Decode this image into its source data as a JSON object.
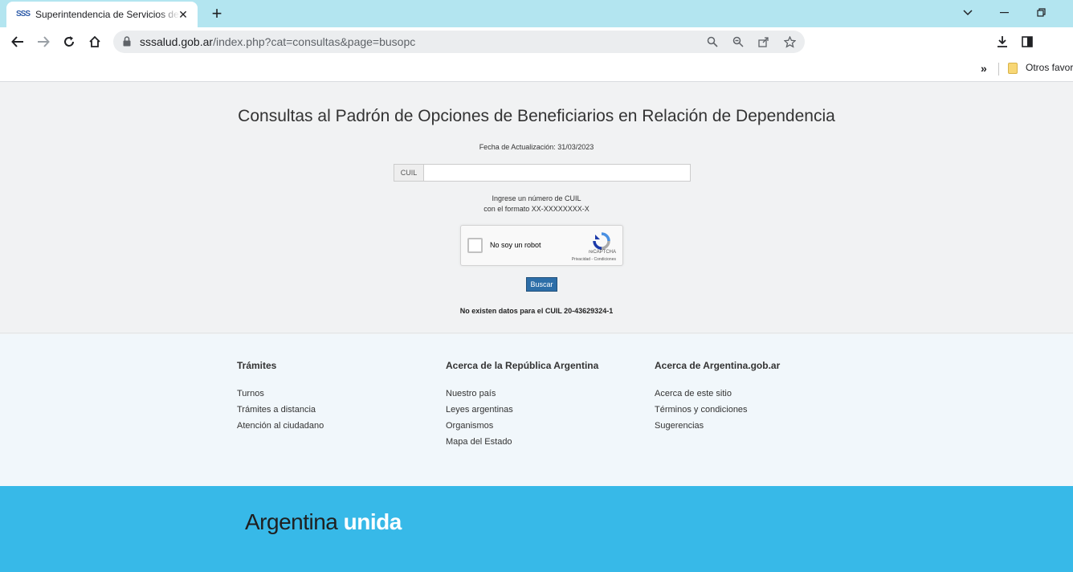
{
  "browser": {
    "tab_favicon": "SSS",
    "tab_title": "Superintendencia de Servicios de Salud",
    "url_host": "sssalud.gob.ar",
    "url_path": "/index.php?cat=consultas&page=busopc",
    "bookmark_label": "Otros favoritos"
  },
  "page": {
    "title": "Consultas al Padrón de Opciones de Beneficiarios en Relación de Dependencia",
    "update_date": "Fecha de Actualización: 31/03/2023",
    "cuil_label": "CUIL",
    "cuil_value": "",
    "help_line1": "Ingrese un número de CUIL",
    "help_line2": "con el formato XX-XXXXXXXX-X",
    "captcha_label": "No soy un robot",
    "captcha_brand": "reCAPTCHA",
    "captcha_terms": "Privacidad - Condiciones",
    "search_button": "Buscar",
    "result_message": "No existen datos para el CUIL 20-43629324-1"
  },
  "footer": {
    "columns": [
      {
        "title": "Trámites",
        "links": [
          "Turnos",
          "Trámites a distancia",
          "Atención al ciudadano"
        ]
      },
      {
        "title": "Acerca de la República Argentina",
        "links": [
          "Nuestro país",
          "Leyes argentinas",
          "Organismos",
          "Mapa del Estado"
        ]
      },
      {
        "title": "Acerca de Argentina.gob.ar",
        "links": [
          "Acerca de este sitio",
          "Términos y condiciones",
          "Sugerencias"
        ]
      }
    ],
    "brand_main": "Argentina",
    "brand_accent": "unida"
  },
  "colors": {
    "tabbar": "#b3e5f0",
    "brand_band": "#37b9e8",
    "search_button": "#2d6ea8"
  }
}
